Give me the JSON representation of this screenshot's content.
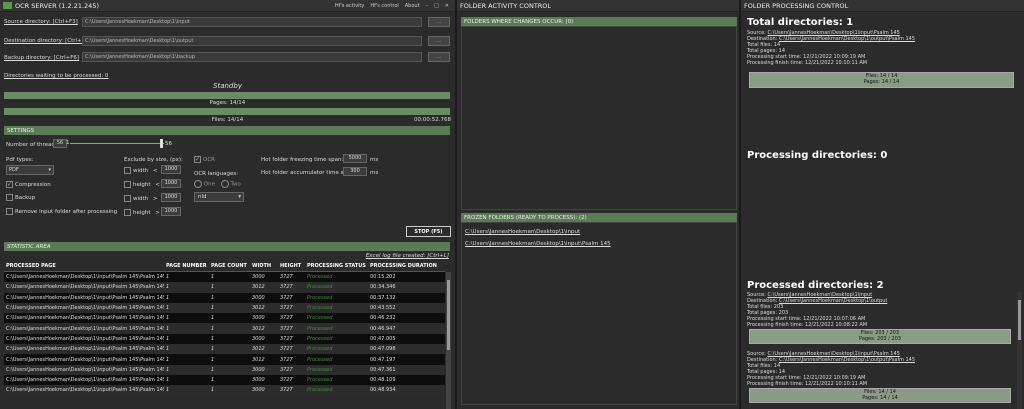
{
  "ocr": {
    "title": "OCR SERVER (1.2.21.245)",
    "menu": [
      "Hf's activity",
      "Hf's control",
      "About"
    ],
    "source_label": "Source directory: [Ctrl+F3]",
    "source_value": "C:\\Users\\JannesHoekman\\Desktop\\1\\input",
    "dest_label": "Destination directory: [Ctrl+F4]",
    "dest_value": "C:\\Users\\JannesHoekman\\Desktop\\1\\output",
    "backup_label": "Backup directory: [Ctrl+F6]",
    "backup_value": "C:\\Users\\JannesHoekman\\Desktop\\1\\backup",
    "browse": "...",
    "waiting": "Directories waiting to be processed: 0",
    "status": "Standby",
    "pages_bar": "Pages: 14/14",
    "files_bar": "Files: 14/14",
    "elapsed": "00:00:52.768",
    "pages_progress": 1.0,
    "files_progress": 1.0,
    "settings": {
      "title": "SETTINGS",
      "threads_label": "Number of threads:",
      "threads_value": "56",
      "slider_max": "56",
      "pdf_label": "Pdf types:",
      "pdf_value": "PDF",
      "compression": "Compression",
      "backup": "Backup",
      "remove": "Remove input folder after processing",
      "exclude_label": "Exclude by size, (px):",
      "rows": [
        {
          "label": "width",
          "op": "<",
          "value": "1000"
        },
        {
          "label": "height",
          "op": "<",
          "value": "1000"
        },
        {
          "label": "width",
          "op": ">",
          "value": "1000"
        },
        {
          "label": "height",
          "op": ">",
          "value": "1000"
        }
      ],
      "ocr": "OCR",
      "ocr_lang": "OCR languages:",
      "one": "One",
      "two": "Two",
      "lang_value": "nld",
      "freeze_label": "Hot folder freezing time span:",
      "freeze_value": "5000",
      "freeze_unit": "ms",
      "accum_label": "Hot folder accumulator time span:",
      "accum_value": "300",
      "accum_unit": "ms",
      "stop": "STOP (F5)"
    },
    "stat": {
      "title": "STATISTIC AREA",
      "excel": "Excel log file created: [Ctrl+L]",
      "headers": [
        "PROCESSED PAGE",
        "PAGE NUMBER",
        "PAGE COUNT",
        "WIDTH",
        "HEIGHT",
        "PROCESSING STATUS",
        "PROCESSING DURATION"
      ],
      "rows": [
        [
          "C:\\Users\\JannesHoekman\\Desktop\\1\\input\\Psalm 145\\Psalm 145",
          "1",
          "1",
          "3000",
          "3727",
          "Processed",
          "00:15.202"
        ],
        [
          "C:\\Users\\JannesHoekman\\Desktop\\1\\input\\Psalm 145\\Psalm 145",
          "1",
          "1",
          "3012",
          "3727",
          "Processed",
          "00:34.346"
        ],
        [
          "C:\\Users\\JannesHoekman\\Desktop\\1\\input\\Psalm 145\\Psalm 145",
          "1",
          "1",
          "3000",
          "3727",
          "Processed",
          "00:37.132"
        ],
        [
          "C:\\Users\\JannesHoekman\\Desktop\\1\\input\\Psalm 145\\Psalm 145",
          "1",
          "1",
          "3012",
          "3727",
          "Processed",
          "00:43.552"
        ],
        [
          "C:\\Users\\JannesHoekman\\Desktop\\1\\input\\Psalm 145\\Psalm 145",
          "1",
          "1",
          "3000",
          "3727",
          "Processed",
          "00:46.232"
        ],
        [
          "C:\\Users\\JannesHoekman\\Desktop\\1\\input\\Psalm 145\\Psalm 145",
          "1",
          "1",
          "3012",
          "3727",
          "Processed",
          "00:46.947"
        ],
        [
          "C:\\Users\\JannesHoekman\\Desktop\\1\\input\\Psalm 145\\Psalm 145",
          "1",
          "1",
          "3000",
          "3727",
          "Processed",
          "00:47.005"
        ],
        [
          "C:\\Users\\JannesHoekman\\Desktop\\1\\input\\Psalm 145\\Psalm 145",
          "1",
          "1",
          "3012",
          "3727",
          "Processed",
          "00:47.098"
        ],
        [
          "C:\\Users\\JannesHoekman\\Desktop\\1\\input\\Psalm 145\\Psalm 145",
          "1",
          "1",
          "3012",
          "3727",
          "Processed",
          "00:47.197"
        ],
        [
          "C:\\Users\\JannesHoekman\\Desktop\\1\\input\\Psalm 145\\Psalm 145",
          "1",
          "1",
          "3000",
          "3727",
          "Processed",
          "00:47.361"
        ],
        [
          "C:\\Users\\JannesHoekman\\Desktop\\1\\input\\Psalm 145\\Psalm 145",
          "1",
          "1",
          "3000",
          "3727",
          "Processed",
          "00:48.109"
        ],
        [
          "C:\\Users\\JannesHoekman\\Desktop\\1\\input\\Psalm 145\\Psalm 145",
          "1",
          "1",
          "3000",
          "3727",
          "Processed",
          "00:48.934"
        ]
      ]
    }
  },
  "activity": {
    "title": "FOLDER ACTIVITY CONTROL",
    "changes": "FOLDERS WHERE CHANGES OCCUR: (0)",
    "frozen": "FROZEN FOLDERS (READY TO PROCESS): (2)",
    "frozen_items": [
      "C:\\Users\\JannesHoekman\\Desktop\\1\\input",
      "C:\\Users\\JannesHoekman\\Desktop\\1\\input\\Psalm 145"
    ]
  },
  "fpc": {
    "title": "FOLDER PROCESSING CONTROL",
    "total": "Total directories: 1",
    "total_info": {
      "source": "C:\\Users\\JannesHoekman\\Desktop\\1\\input\\Psalm 145",
      "dest": "C:\\Users\\JannesHoekman\\Desktop\\1\\output\\Psalm 145",
      "files": "14",
      "pages": "14",
      "start": "12/21/2022 10:09:19 AM",
      "finish": "12/21/2022 10:10:11 AM",
      "files_bar": "Files: 14 / 14",
      "pages_bar": "Pages: 14 / 14"
    },
    "processing": "Processing directories: 0",
    "processed": "Processed directories: 2",
    "labels": {
      "source": "Source:",
      "dest": "Destination:",
      "files": "Total files:",
      "pages": "Total pages:",
      "start": "Processing start time:",
      "finish": "Processing finish time:"
    },
    "processed_items": [
      {
        "source": "C:\\Users\\JannesHoekman\\Desktop\\1\\input",
        "dest": "C:\\Users\\JannesHoekman\\Desktop\\1\\output",
        "files": "203",
        "pages": "203",
        "start": "12/21/2022 10:07:06 AM",
        "finish": "12/21/2022 10:08:22 AM",
        "files_bar": "Files: 203 / 203",
        "pages_bar": "Pages: 203 / 203"
      },
      {
        "source": "C:\\Users\\JannesHoekman\\Desktop\\1\\input\\Psalm 145",
        "dest": "C:\\Users\\JannesHoekman\\Desktop\\1\\output\\Psalm 145",
        "files": "14",
        "pages": "14",
        "start": "12/21/2022 10:09:19 AM",
        "finish": "12/21/2022 10:10:11 AM",
        "files_bar": "Files: 14 / 14",
        "pages_bar": "Pages: 14 / 14"
      }
    ]
  }
}
